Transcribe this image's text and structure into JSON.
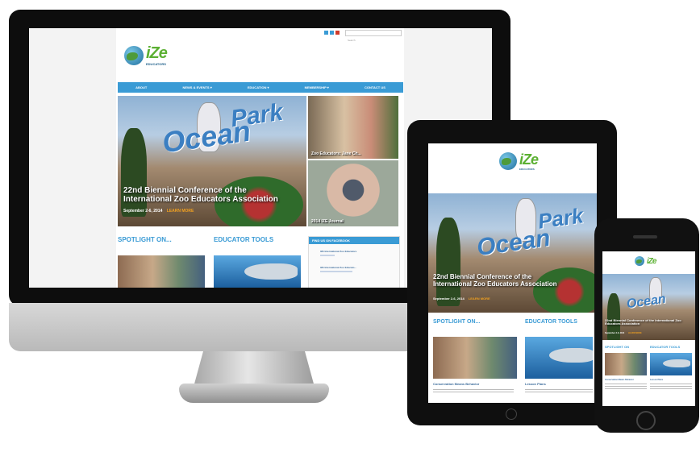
{
  "colors": {
    "accent": "#3a9bd5",
    "logo_green": "#5bb032",
    "learn_more": "#f0a020"
  },
  "logo": {
    "wordmark": "iZe",
    "subtitle": "EDUCATORS"
  },
  "desktop": {
    "search_placeholder": "Search",
    "nav": [
      "About",
      "News & Events ▾",
      "Education ▾",
      "Membership ▾",
      "Contact Us"
    ],
    "hero": {
      "sign_line1": "Ocean",
      "sign_line2": "Park",
      "title_line1": "22nd Biennial Conference of the",
      "title_line2": "International Zoo Educators Association",
      "date": "September 2-6, 2014",
      "learn_more": "LEARN MORE"
    },
    "side_stories": [
      "Zoo Educators: Jane Ch...",
      "2014 IZE Journal"
    ],
    "sections": {
      "spotlight": "SPOTLIGHT ON...",
      "tools": "EDUCATOR TOOLS",
      "facebook": "FIND US ON FACEBOOK"
    },
    "facebook_entries": [
      "IZE International Zoo Educators",
      "IZE International Zoo Educato..."
    ]
  },
  "tablet": {
    "hero": {
      "title_line1": "22nd Biennial Conference of the",
      "title_line2": "International Zoo Educators Association",
      "date": "September 2-6, 2014",
      "learn_more": "LEARN MORE"
    },
    "sections": {
      "spotlight": "SPOTLIGHT ON...",
      "tools": "EDUCATOR TOOLS"
    },
    "captions": [
      "Conservation Means Behavior",
      "Lesson Plans"
    ]
  },
  "phone": {
    "hero": {
      "title": "22nd Biennial Conference of the International Zoo Educators Association",
      "date": "September 2-6, 2014",
      "learn_more": "LEARN MORE"
    },
    "sections": {
      "spotlight": "SPOTLIGHT ON",
      "tools": "EDUCATOR TOOLS"
    },
    "captions": [
      "Conservation Means Behavior",
      "Lesson Plans"
    ]
  },
  "icons": [
    "apple-logo-icon",
    "facebook-icon",
    "twitter-icon",
    "share-icon"
  ]
}
